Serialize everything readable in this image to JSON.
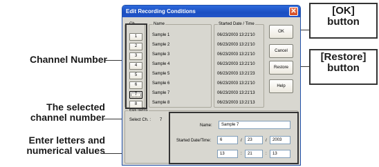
{
  "callouts": {
    "channel_number": "Channel Number",
    "selected_channel": [
      "The selected",
      "channel number"
    ],
    "enter_values": [
      "Enter letters and",
      "numerical values"
    ],
    "ok_button": [
      "[OK]",
      "button"
    ],
    "restore_button": [
      "[Restore]",
      "button"
    ]
  },
  "dialog": {
    "title": "Edit Recording Conditions",
    "close_glyph": "✕",
    "ch_header": "Ch.",
    "name_header": "Name",
    "date_header": "Started Date / Time",
    "channels": [
      {
        "num": "1",
        "name": "Sample 1",
        "date": "06/23/2003 13:21'10"
      },
      {
        "num": "2",
        "name": "Sample 2",
        "date": "06/23/2003 13:21'10"
      },
      {
        "num": "3",
        "name": "Sample 3",
        "date": "06/23/2003 13:21'10"
      },
      {
        "num": "4",
        "name": "Sample 4",
        "date": "06/23/2003 13:21'10"
      },
      {
        "num": "5",
        "name": "Sample 5",
        "date": "06/23/2003 13:21'23"
      },
      {
        "num": "6",
        "name": "Sample 6",
        "date": "06/23/2003 13:21'10"
      },
      {
        "num": "7",
        "name": "Sample 7",
        "date": "06/23/2003 13:21'13"
      },
      {
        "num": "8",
        "name": "Sample 8",
        "date": "06/23/2003 13:21'13"
      }
    ],
    "buttons": {
      "ok": "OK",
      "cancel": "Cancel",
      "restore": "Restore",
      "help": "Help"
    },
    "edit_items": {
      "label": "Edit Items",
      "select_ch_label": "Select Ch. :",
      "select_ch_value": "7",
      "name_label": "Name:",
      "name_value": "Sample 7",
      "started_label": "Started Date/Time:",
      "month": "6",
      "day": "23",
      "year": "2003",
      "hour": "13",
      "minute": "21",
      "second": "13",
      "date_sep": "/",
      "time_sep": ":"
    }
  }
}
